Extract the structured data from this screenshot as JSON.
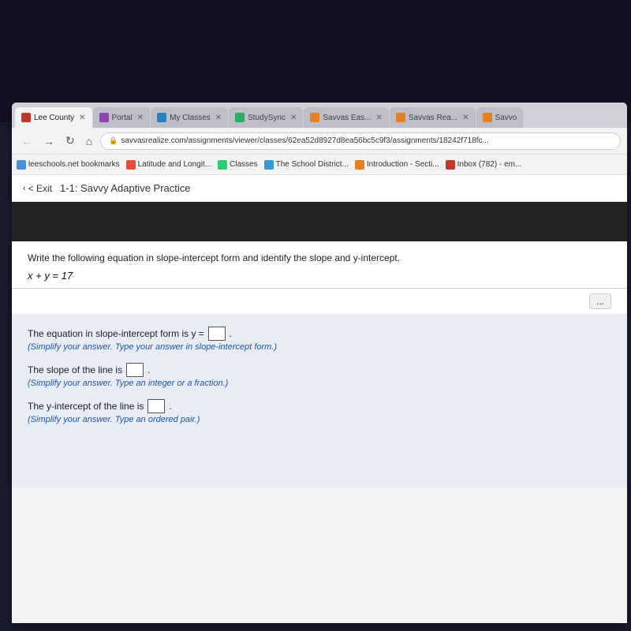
{
  "topBg": {},
  "tabs": [
    {
      "id": "lee-county",
      "label": "Lee County",
      "active": true,
      "color": "#c0392b"
    },
    {
      "id": "portal",
      "label": "Portal",
      "active": false,
      "color": "#8e44ad"
    },
    {
      "id": "my-classes",
      "label": "My Classes",
      "active": false,
      "color": "#2980b9"
    },
    {
      "id": "studysync",
      "label": "StudySync",
      "active": false,
      "color": "#27ae60"
    },
    {
      "id": "savvas-easy",
      "label": "Savvas Eas...",
      "active": false,
      "color": "#e67e22"
    },
    {
      "id": "savvas-real",
      "label": "Savvas Rea...",
      "active": false,
      "color": "#e67e22"
    },
    {
      "id": "savvo",
      "label": "Savvo",
      "active": false,
      "color": "#e67e22"
    }
  ],
  "address_bar": {
    "url": "savvasrealize.com/assignments/viewer/classes/62ea52d8927d8ea56bc5c9f3/assignments/18242f718fc..."
  },
  "bookmarks": [
    {
      "label": "leeschools.net bookmarks"
    },
    {
      "label": "Latitude and Longit..."
    },
    {
      "label": "Classes"
    },
    {
      "label": "The School District..."
    },
    {
      "label": "Introduction - Secti..."
    },
    {
      "label": "Inbox (782) - em..."
    }
  ],
  "page_header": {
    "exit_label": "< Exit",
    "title": "1-1: Savvy Adaptive Practice"
  },
  "question": {
    "instruction": "Write the following equation in slope-intercept form and identify the slope and y-intercept.",
    "equation": "x + y = 17"
  },
  "dots_button": "...",
  "answers": [
    {
      "prefix": "The equation in slope-intercept form is y =",
      "has_box": true,
      "suffix": ".",
      "hint": "(Simplify your answer. Type your answer in slope-intercept form.)"
    },
    {
      "prefix": "The slope of the line is",
      "has_box": true,
      "suffix": ".",
      "hint": "(Simplify your answer. Type an integer or a fraction.)"
    },
    {
      "prefix": "The y-intercept of the line is",
      "has_box": true,
      "suffix": ".",
      "hint": "(Simplify your answer. Type an ordered pair.)"
    }
  ]
}
